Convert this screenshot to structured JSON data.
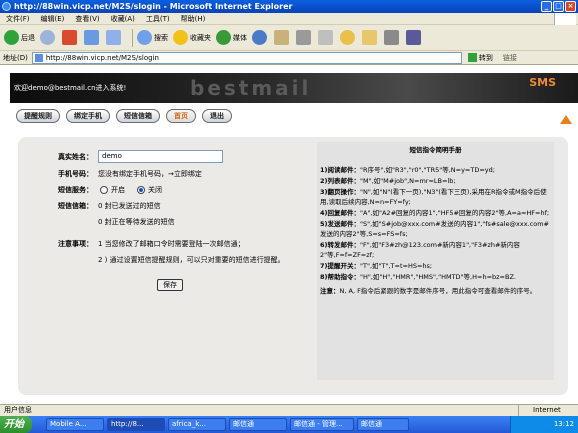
{
  "window": {
    "title": "http://88win.vicp.net/M2S/slogin - Microsoft Internet Explorer",
    "minimize": "_",
    "maximize": "□",
    "close": "×"
  },
  "menu": [
    "文件(F)",
    "编辑(E)",
    "查看(V)",
    "收藏(A)",
    "工具(T)",
    "帮助(H)"
  ],
  "toolbar": {
    "back": "后退",
    "search": "搜索",
    "favorites": "收藏夹",
    "media": "媒体"
  },
  "address": {
    "label": "地址(D)",
    "url": "http://88win.vicp.net/M2S/slogin",
    "go": "转到",
    "links": "链接"
  },
  "banner": {
    "welcome": "欢迎demo@bestmail.cn进入系统!",
    "logo": "bestmail",
    "sms": "SMS"
  },
  "nav": [
    "提醒规则",
    "绑定手机",
    "短信信箱",
    "首页",
    "退出"
  ],
  "form": {
    "name_label": "真实姓名：",
    "name_value": "demo",
    "phone_label": "手机号码：",
    "phone_text": "您没有绑定手机号码，→立即绑定",
    "service_label": "短信服务：",
    "service_on": "开启",
    "service_off": "关闭",
    "inbox_label": "短信信箱：",
    "inbox_sent": "0 封已发送过的短信",
    "inbox_unsent": "0 封正在等待发送的短信",
    "notice_label": "注意事项：",
    "notice1": "1 当您修改了邮箱口令时需要登陆一次邮信通；",
    "notice2": "2 ) 通过设置短信提醒规则，可以只对重要的短信进行提醒。",
    "save": "保存"
  },
  "help": {
    "title": "短信指令简明手册",
    "items": [
      {
        "b": "1)阅读邮件：",
        "t": "\"R序号\",如\"R3\",\"r0\",\"TR5\"等,N=y=TD=yd;"
      },
      {
        "b": "2)列表邮件：",
        "t": "\"M\",如\"M#job\",N=mr=LB=lb;"
      },
      {
        "b": "3)翻页操作：",
        "t": "\"N\",如\"N\"(看下一页),\"N3\"(看下三页),采用在R指令或M指令后使用,读取后续内容,N=n=FY=fy;"
      },
      {
        "b": "4)回复邮件：",
        "t": "\"A\",如\"A2#回复的内容1\",\"HF5#回复的内容2\"等,A=a=HF=hf;"
      },
      {
        "b": "5)发送邮件：",
        "t": "\"S\",如\"S#job@xxx.com#发送的内容1\",\"fs#sale@xxx.com#发送的内容2\"等,S=s=FS=fs;"
      },
      {
        "b": "6)转发邮件：",
        "t": "\"F\",如\"F3#zh@123.com#新内容1\",\"F3#zh#新内容2\"等,F=f=ZF=zf;"
      },
      {
        "b": "7)提醒开关：",
        "t": "\"T\",如\"T\",T=t=HS=hs;"
      },
      {
        "b": "8)帮助指令：",
        "t": "\"H\",如\"H\",\"HMR\",\"HMS\",\"HMTD\"等,H=h=bz=BZ."
      }
    ],
    "note_b": "注意：",
    "note": "N, A, F指令后紧跟的数字是邮件序号，用此指令可查看邮件的序号。"
  },
  "status": {
    "text": "用户信息",
    "zone": "Internet"
  },
  "taskbar": {
    "start": "开始",
    "tasks": [
      "Mobile A...",
      "http://8...",
      "africa_k...",
      "邮信通",
      "邮信通 - 管理...",
      "邮信通"
    ],
    "clock": "13:12"
  }
}
